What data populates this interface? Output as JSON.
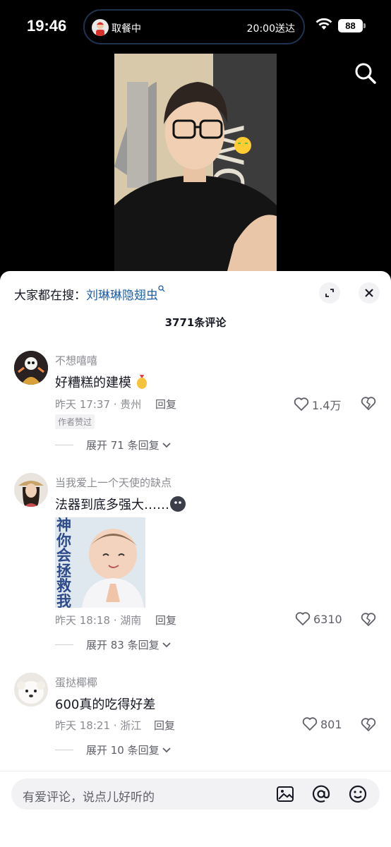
{
  "status": {
    "time": "19:46",
    "island_left": "取餐中",
    "island_right": "20:00送达",
    "battery": "88"
  },
  "hot_search": {
    "prefix": "大家都在搜：",
    "keyword": "刘琳琳隐翅虫"
  },
  "comments_title": "3771条评论",
  "comments": [
    {
      "name": "不想嘻嘻",
      "text": "好糟糕的建模",
      "time_location": "昨天 17:37 · 贵州",
      "reply": "回复",
      "likes": "1.4万",
      "tag": "作者赞过",
      "expand": "展开 71 条回复"
    },
    {
      "name": "当我爱上一个天使的缺点",
      "text": "法器到底多强大……",
      "image_caption": "神你会拯救我吗",
      "time_location": "昨天 18:18 · 湖南",
      "reply": "回复",
      "likes": "6310",
      "expand": "展开 83 条回复"
    },
    {
      "name": "蛋挞椰椰",
      "text": "600真的吃得好差",
      "time_location": "昨天 18:21 · 浙江",
      "reply": "回复",
      "likes": "801",
      "expand": "展开 10 条回复"
    }
  ],
  "input": {
    "placeholder": "有爱评论，说点儿好听的"
  },
  "colors": {
    "keyword": "#1f5fa8",
    "meta": "#8a8b91",
    "text": "#161823"
  }
}
